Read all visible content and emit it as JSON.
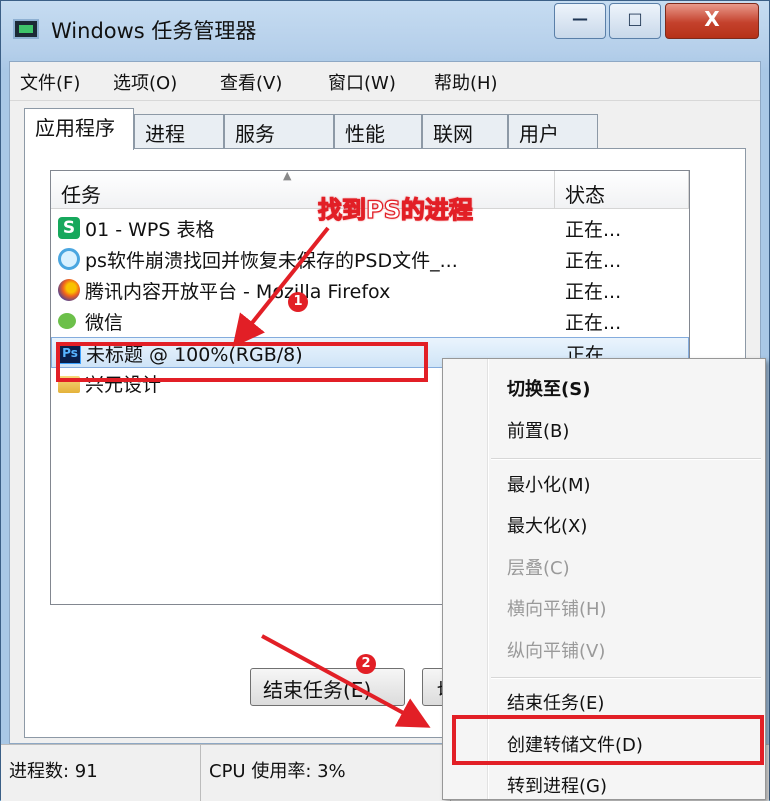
{
  "window": {
    "title": "Windows 任务管理器",
    "controls": {
      "minimize": "—",
      "maximize": "□",
      "close": "X"
    }
  },
  "menubar": [
    "文件(F)",
    "选项(O)",
    "查看(V)",
    "窗口(W)",
    "帮助(H)"
  ],
  "tabs": [
    "应用程序",
    "进程",
    "服务",
    "性能",
    "联网",
    "用户"
  ],
  "active_tab": "应用程序",
  "task_list": {
    "columns": {
      "task": "任务",
      "status": "状态"
    },
    "rows": [
      {
        "icon": "wps-spreadsheet-icon",
        "name": "01 - WPS 表格",
        "status": "正在..."
      },
      {
        "icon": "ie-browser-icon",
        "name": "ps软件崩溃找回并恢复未保存的PSD文件_...",
        "status": "正在..."
      },
      {
        "icon": "firefox-icon",
        "name": "腾讯内容开放平台 - Mozilla Firefox",
        "status": "正在..."
      },
      {
        "icon": "wechat-icon",
        "name": "微信",
        "status": "正在..."
      },
      {
        "icon": "photoshop-icon",
        "name": "未标题      @ 100%(RGB/8)",
        "status": "正在..."
      },
      {
        "icon": "folder-icon",
        "name": "兴元设计",
        "status": ""
      }
    ],
    "selected_index": 4
  },
  "buttons": {
    "end_task": "结束任务(E)",
    "switch_to": "切"
  },
  "statusbar": {
    "processes": "进程数: 91",
    "cpu": "CPU 使用率: 3%"
  },
  "context_menu": {
    "items": [
      {
        "label": "切换至(S)",
        "bold": true
      },
      {
        "label": "前置(B)"
      },
      {
        "separator": true
      },
      {
        "label": "最小化(M)"
      },
      {
        "label": "最大化(X)"
      },
      {
        "label": "层叠(C)",
        "disabled": true
      },
      {
        "label": "横向平铺(H)",
        "disabled": true
      },
      {
        "label": "纵向平铺(V)",
        "disabled": true
      },
      {
        "separator": true
      },
      {
        "label": "结束任务(E)"
      },
      {
        "label": "创建转储文件(D)",
        "highlighted": true
      },
      {
        "label": "转到进程(G)"
      }
    ]
  },
  "annotations": {
    "callout_text": "找到PS的进程",
    "step1": "1",
    "step2": "2",
    "color": "#e21f26"
  }
}
